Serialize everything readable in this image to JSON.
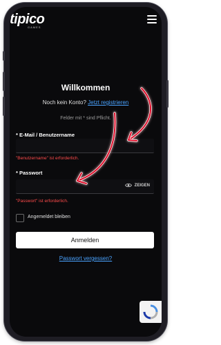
{
  "brand": {
    "logo_text": "tipico",
    "logo_sub": "GAMES"
  },
  "login": {
    "title": "Willkommen",
    "no_account_text": "Noch kein Konto?",
    "register_link": "Jetzt registrieren",
    "required_note": "Felder mit * sind Pflicht.",
    "username_label": "* E-Mail / Benutzername",
    "username_value": "",
    "username_error": "\"Benutzername\" ist erforderlich.",
    "password_label": "* Passwort",
    "password_value": "",
    "show_password_label": "ZEIGEN",
    "password_error": "\"Passwort\" ist erforderlich.",
    "remember_label": "Angemeldet bleiben",
    "remember_checked": false,
    "submit_label": "Anmelden",
    "forgot_link": "Passwort vergessen?"
  },
  "colors": {
    "background": "#0a0a0c",
    "accent_link": "#4aa3ff",
    "error": "#ff4b4b",
    "annotation_arrow": "#e0102a"
  },
  "icons": [
    "menu-icon",
    "eye-icon",
    "recaptcha-icon"
  ]
}
